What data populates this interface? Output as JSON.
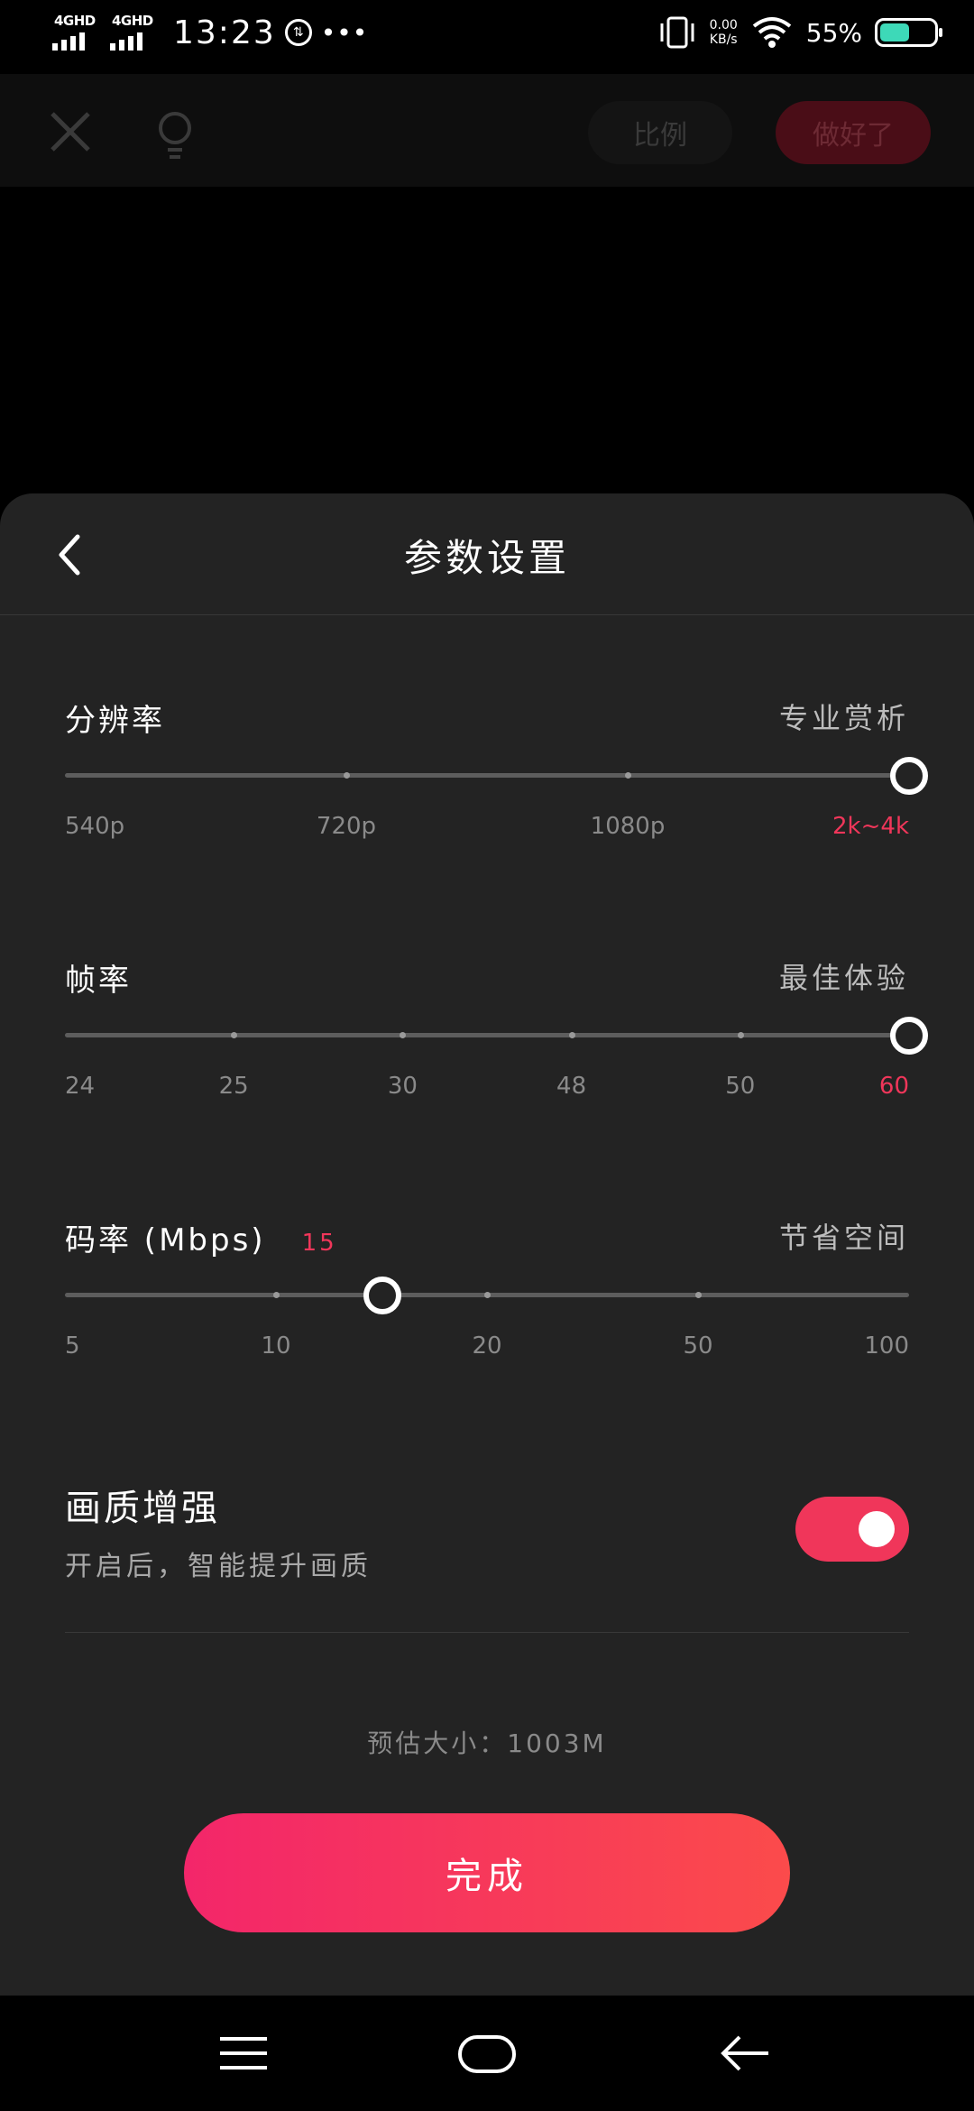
{
  "status_bar": {
    "signal1": "4GHD",
    "signal2": "4GHD",
    "time": "13:23",
    "icon_glyph": "⇅",
    "dots": "•••",
    "net_speed": "0.00",
    "net_unit": "KB/s",
    "battery": "55%",
    "battery_level": 0.55
  },
  "toolbar": {
    "ratio_label": "比例",
    "done_label": "做好了"
  },
  "sheet": {
    "title": "参数设置",
    "resolution": {
      "title": "分辨率",
      "desc": "专业赏析",
      "options": [
        "540p",
        "720p",
        "1080p",
        "2k~4k"
      ],
      "selected_index": 3
    },
    "framerate": {
      "title": "帧率",
      "desc": "最佳体验",
      "options": [
        "24",
        "25",
        "30",
        "48",
        "50",
        "60"
      ],
      "selected_index": 5
    },
    "bitrate": {
      "title": "码率 (Mbps)",
      "value": "15",
      "desc": "节省空间",
      "options": [
        "5",
        "10",
        "20",
        "50",
        "100"
      ],
      "knob_fraction": 0.376
    },
    "enhance": {
      "title": "画质增强",
      "subtitle": "开启后，智能提升画质",
      "enabled": true
    },
    "estimate": "预估大小：1003M",
    "done_button": "完成"
  },
  "colors": {
    "accent": "#f0365a",
    "sheet_bg": "#232323"
  }
}
